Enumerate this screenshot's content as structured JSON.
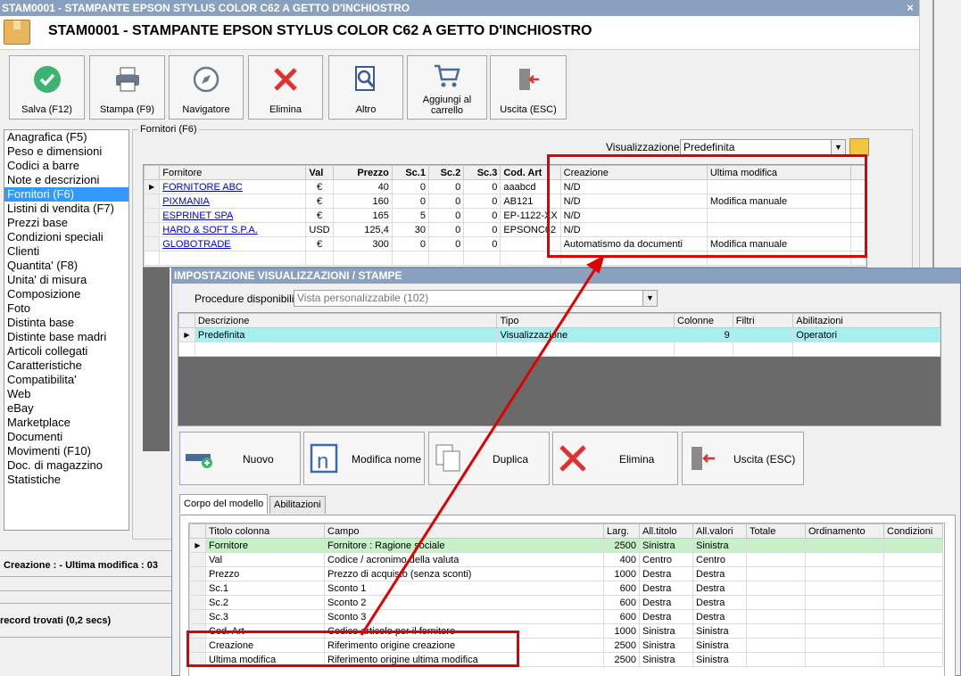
{
  "window": {
    "titlebar": "STAM0001 - STAMPANTE EPSON STYLUS COLOR C62 A GETTO D'INCHIOSTRO",
    "close": "×",
    "title": "STAM0001 - STAMPANTE EPSON STYLUS COLOR C62 A GETTO D'INCHIOSTRO"
  },
  "toolbar": {
    "save": "Salva (F12)",
    "print": "Stampa (F9)",
    "navigator": "Navigatore",
    "delete": "Elimina",
    "other": "Altro",
    "add_cart": "Aggiungi al carrello",
    "exit": "Uscita (ESC)"
  },
  "sidebar": {
    "items": [
      "Anagrafica (F5)",
      "Peso e dimensioni",
      "Codici a barre",
      "Note e descrizioni",
      "Fornitori (F6)",
      "Listini di vendita (F7)",
      "Prezzi base",
      "Condizioni speciali",
      "Clienti",
      "Quantita' (F8)",
      "Unita' di misura",
      "Composizione",
      "Foto",
      "Distinta base",
      "Distinte base madri",
      "Articoli collegati",
      "Caratteristiche",
      "Compatibilita'",
      "Web",
      "eBay",
      "Marketplace",
      "Documenti",
      "Movimenti (F10)",
      "Doc. di magazzino",
      "Statistiche"
    ],
    "selected_index": 4
  },
  "status": {
    "line1": "Creazione : - Ultima modifica : 03",
    "line2": "record trovati (0,2 secs)"
  },
  "fornitori": {
    "group_label": "Fornitori (F6)",
    "view_label": "Visualizzazione :",
    "view_value": "Predefinita",
    "columns": [
      "Fornitore",
      "Val",
      "Prezzo",
      "Sc.1",
      "Sc.2",
      "Sc.3",
      "Cod. Art",
      "Creazione",
      "Ultima modifica"
    ],
    "rows": [
      [
        "FORNITORE ABC",
        "€",
        "40",
        "0",
        "0",
        "0",
        "aaabcd",
        "N/D",
        ""
      ],
      [
        "PIXMANIA",
        "€",
        "160",
        "0",
        "0",
        "0",
        "AB121",
        "N/D",
        "Modifica manuale"
      ],
      [
        "ESPRINET SPA",
        "€",
        "165",
        "5",
        "0",
        "0",
        "EP-1122-XX",
        "N/D",
        ""
      ],
      [
        "HARD & SOFT S.P.A.",
        "USD",
        "125,4",
        "30",
        "0",
        "0",
        "EPSONC62",
        "N/D",
        ""
      ],
      [
        "GLOBOTRADE",
        "€",
        "300",
        "0",
        "0",
        "0",
        "",
        "Automatismo da documenti",
        "Modifica manuale"
      ]
    ]
  },
  "dialog": {
    "title": "IMPOSTAZIONE VISUALIZZAZIONI / STAMPE",
    "proc_label": "Procedure disponibili :",
    "proc_value": "Vista personalizzabile (102)",
    "views_columns": [
      "Descrizione",
      "Tipo",
      "Colonne",
      "Filtri",
      "Abilitazioni"
    ],
    "views_rows": [
      [
        "Predefinita",
        "Visualizzazione",
        "9",
        "",
        "Operatori"
      ]
    ],
    "buttons": {
      "new": "Nuovo",
      "rename": "Modifica nome",
      "duplicate": "Duplica",
      "delete": "Elimina",
      "exit": "Uscita (ESC)"
    },
    "tabs": [
      "Corpo del modello",
      "Abilitazioni"
    ],
    "model_columns": [
      "Titolo colonna",
      "Campo",
      "Larg.",
      "All.titolo",
      "All.valori",
      "Totale",
      "Ordinamento",
      "Condizioni"
    ],
    "model_rows": [
      [
        "Fornitore",
        "Fornitore : Ragione sociale",
        "2500",
        "Sinistra",
        "Sinistra",
        "",
        "",
        ""
      ],
      [
        "Val",
        "Codice / acronimo della valuta",
        "400",
        "Centro",
        "Centro",
        "",
        "",
        ""
      ],
      [
        "Prezzo",
        "Prezzo di acquisto (senza sconti)",
        "1000",
        "Destra",
        "Destra",
        "",
        "",
        ""
      ],
      [
        "Sc.1",
        "Sconto 1",
        "600",
        "Destra",
        "Destra",
        "",
        "",
        ""
      ],
      [
        "Sc.2",
        "Sconto 2",
        "600",
        "Destra",
        "Destra",
        "",
        "",
        ""
      ],
      [
        "Sc.3",
        "Sconto 3",
        "600",
        "Destra",
        "Destra",
        "",
        "",
        ""
      ],
      [
        "Cod. Art",
        "Codice articolo per il fornitore",
        "1000",
        "Sinistra",
        "Sinistra",
        "",
        "",
        ""
      ],
      [
        "Creazione",
        "Riferimento origine creazione",
        "2500",
        "Sinistra",
        "Sinistra",
        "",
        "",
        ""
      ],
      [
        "Ultima modifica",
        "Riferimento origine ultima modifica",
        "2500",
        "Sinistra",
        "Sinistra",
        "",
        "",
        ""
      ]
    ]
  },
  "colors": {
    "titlebar": "#8aa0bf",
    "selection": "#3399ff",
    "highlight_red": "#e00000",
    "link": "#0000c8",
    "row_cyan": "#a8f0f0",
    "row_green": "#c8f0c8"
  },
  "icons": [
    "check-icon",
    "printer-icon",
    "compass-icon",
    "delete-x-icon",
    "search-doc-icon",
    "cart-icon",
    "exit-door-icon",
    "new-item-icon",
    "rename-icon",
    "duplicate-icon"
  ]
}
